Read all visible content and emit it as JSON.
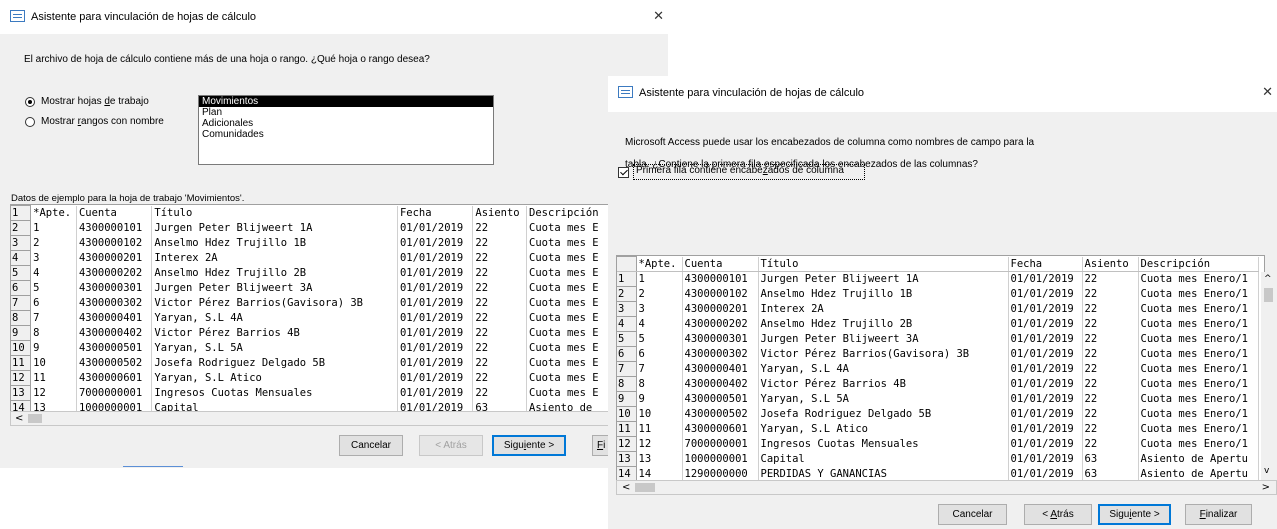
{
  "window1": {
    "title": "Asistente para vinculación de hojas de cálculo",
    "close_glyph": "✕",
    "prompt": "El archivo de hoja de cálculo contiene más de una hoja o rango. ¿Qué hoja o rango desea?",
    "radio_sheets": {
      "pre": "Mostrar hojas ",
      "key": "d",
      "post": "e trabajo",
      "selected": true
    },
    "radio_ranges": {
      "pre": "Mostrar ",
      "key": "r",
      "post": "angos con nombre",
      "selected": false
    },
    "sheets": [
      "Movimientos",
      "Plan",
      "Adicionales",
      "Comunidades"
    ],
    "sample_caption": "Datos de ejemplo para la hoja de trabajo 'Movimientos'.",
    "buttons": {
      "cancel": "Cancelar",
      "back": "< Atrás",
      "next_pre": "Sigu",
      "next_key": "i",
      "next_post": "ente >",
      "finish_key": "F",
      "finish_rest": "i"
    },
    "grid": {
      "rows": [
        [
          "1",
          "*Apte.",
          "Cuenta",
          "Título",
          "Fecha",
          "Asiento",
          "Descripción"
        ],
        [
          "2",
          "1",
          "4300000101",
          "Jurgen Peter Blijweert 1A",
          "01/01/2019",
          "22",
          "Cuota mes E"
        ],
        [
          "3",
          "2",
          "4300000102",
          "Anselmo Hdez Trujillo 1B",
          "01/01/2019",
          "22",
          "Cuota mes E"
        ],
        [
          "4",
          "3",
          "4300000201",
          "Interex 2A",
          "01/01/2019",
          "22",
          "Cuota mes E"
        ],
        [
          "5",
          "4",
          "4300000202",
          "Anselmo Hdez Trujillo 2B",
          "01/01/2019",
          "22",
          "Cuota mes E"
        ],
        [
          "6",
          "5",
          "4300000301",
          "Jurgen Peter Blijweert  3A",
          "01/01/2019",
          "22",
          "Cuota mes E"
        ],
        [
          "7",
          "6",
          "4300000302",
          "Victor Pérez Barrios(Gavisora) 3B",
          "01/01/2019",
          "22",
          "Cuota mes E"
        ],
        [
          "8",
          "7",
          "4300000401",
          "Yaryan, S.L 4A",
          "01/01/2019",
          "22",
          "Cuota mes E"
        ],
        [
          "9",
          "8",
          "4300000402",
          "Victor Pérez Barrios 4B",
          "01/01/2019",
          "22",
          "Cuota mes E"
        ],
        [
          "10",
          "9",
          "4300000501",
          "Yaryan, S.L 5A",
          "01/01/2019",
          "22",
          "Cuota mes E"
        ],
        [
          "11",
          "10",
          "4300000502",
          "Josefa Rodriguez Delgado 5B",
          "01/01/2019",
          "22",
          "Cuota mes E"
        ],
        [
          "12",
          "11",
          "4300000601",
          "Yaryan, S.L Atico",
          "01/01/2019",
          "22",
          "Cuota mes E"
        ],
        [
          "13",
          "12",
          "7000000001",
          "Ingresos Cuotas Mensuales",
          "01/01/2019",
          "22",
          "Cuota mes E"
        ],
        [
          "14",
          "13",
          "1000000001",
          "Capital",
          "01/01/2019",
          "63",
          "Asiento de"
        ]
      ]
    }
  },
  "window2": {
    "title": "Asistente para vinculación de hojas de cálculo",
    "close_glyph": "✕",
    "prompt_line1": "Microsoft Access puede usar los encabezados de columna como nombres de campo para la",
    "prompt_line2": "tabla. ¿Contiene la primera fila especificada los encabezados de las columnas?",
    "checkbox": {
      "pre": "Primera fila contiene encabe",
      "key": "z",
      "post": "ados de columna",
      "checked": true
    },
    "buttons": {
      "cancel": "Cancelar",
      "back_pre": "< ",
      "back_key": "A",
      "back_post": "trás",
      "next_pre": "Sigu",
      "next_key": "i",
      "next_post": "ente >",
      "finish_key": "F",
      "finish_post": "inalizar"
    },
    "grid": {
      "headers": [
        "",
        "*Apte.",
        "Cuenta",
        "Título",
        "Fecha",
        "Asiento",
        "Descripción"
      ],
      "rows": [
        [
          "1",
          "1",
          "4300000101",
          "Jurgen Peter Blijweert 1A",
          "01/01/2019",
          "22",
          "Cuota mes Enero/1"
        ],
        [
          "2",
          "2",
          "4300000102",
          "Anselmo Hdez Trujillo 1B",
          "01/01/2019",
          "22",
          "Cuota mes Enero/1"
        ],
        [
          "3",
          "3",
          "4300000201",
          "Interex 2A",
          "01/01/2019",
          "22",
          "Cuota mes Enero/1"
        ],
        [
          "4",
          "4",
          "4300000202",
          "Anselmo Hdez Trujillo 2B",
          "01/01/2019",
          "22",
          "Cuota mes Enero/1"
        ],
        [
          "5",
          "5",
          "4300000301",
          "Jurgen Peter Blijweert  3A",
          "01/01/2019",
          "22",
          "Cuota mes Enero/1"
        ],
        [
          "6",
          "6",
          "4300000302",
          "Victor Pérez Barrios(Gavisora) 3B",
          "01/01/2019",
          "22",
          "Cuota mes Enero/1"
        ],
        [
          "7",
          "7",
          "4300000401",
          "Yaryan, S.L 4A",
          "01/01/2019",
          "22",
          "Cuota mes Enero/1"
        ],
        [
          "8",
          "8",
          "4300000402",
          "Victor Pérez Barrios 4B",
          "01/01/2019",
          "22",
          "Cuota mes Enero/1"
        ],
        [
          "9",
          "9",
          "4300000501",
          "Yaryan, S.L 5A",
          "01/01/2019",
          "22",
          "Cuota mes Enero/1"
        ],
        [
          "10",
          "10",
          "4300000502",
          "Josefa Rodriguez Delgado 5B",
          "01/01/2019",
          "22",
          "Cuota mes Enero/1"
        ],
        [
          "11",
          "11",
          "4300000601",
          "Yaryan, S.L Atico",
          "01/01/2019",
          "22",
          "Cuota mes Enero/1"
        ],
        [
          "12",
          "12",
          "7000000001",
          "Ingresos Cuotas Mensuales",
          "01/01/2019",
          "22",
          "Cuota mes Enero/1"
        ],
        [
          "13",
          "13",
          "1000000001",
          "Capital",
          "01/01/2019",
          "63",
          "Asiento de Apertu"
        ],
        [
          "14",
          "14",
          "1290000000",
          "PERDIDAS Y GANANCIAS",
          "01/01/2019",
          "63",
          "Asiento de Apertu"
        ]
      ]
    }
  },
  "icons": {
    "scroll_left": "<",
    "scroll_right": ">",
    "scroll_up": "^",
    "scroll_down": "v"
  }
}
